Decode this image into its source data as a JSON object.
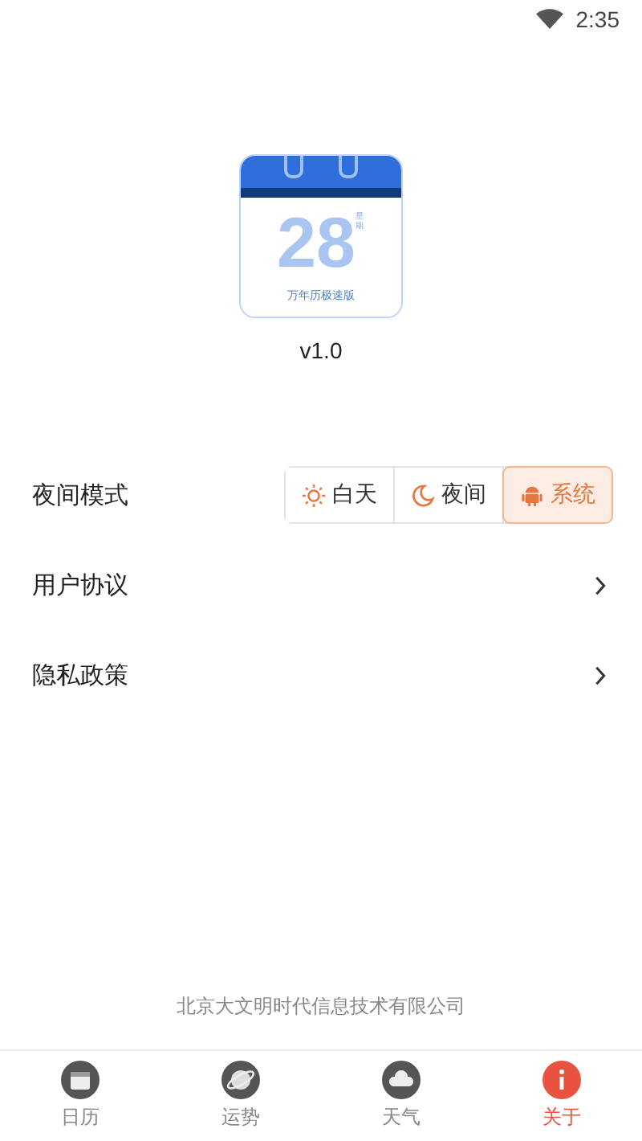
{
  "status_bar": {
    "time": "2:35"
  },
  "app_logo": {
    "day": "28",
    "side_label": "星期",
    "caption": "万年历极速版"
  },
  "version": "v1.0",
  "settings": [
    {
      "kind": "segmented",
      "label": "夜间模式",
      "options": [
        {
          "kind": "sun",
          "label": "白天",
          "selected": false
        },
        {
          "kind": "moon",
          "label": "夜间",
          "selected": false
        },
        {
          "kind": "android",
          "label": "系统",
          "selected": true
        }
      ]
    },
    {
      "kind": "link",
      "label": "用户协议"
    },
    {
      "kind": "link",
      "label": "隐私政策"
    }
  ],
  "company": "北京大文明时代信息技术有限公司",
  "tab_bar": [
    {
      "kind": "calendar",
      "label": "日历",
      "selected": false
    },
    {
      "kind": "planet",
      "label": "运势",
      "selected": false
    },
    {
      "kind": "weather",
      "label": "天气",
      "selected": false
    },
    {
      "kind": "info",
      "label": "关于",
      "selected": true
    }
  ]
}
